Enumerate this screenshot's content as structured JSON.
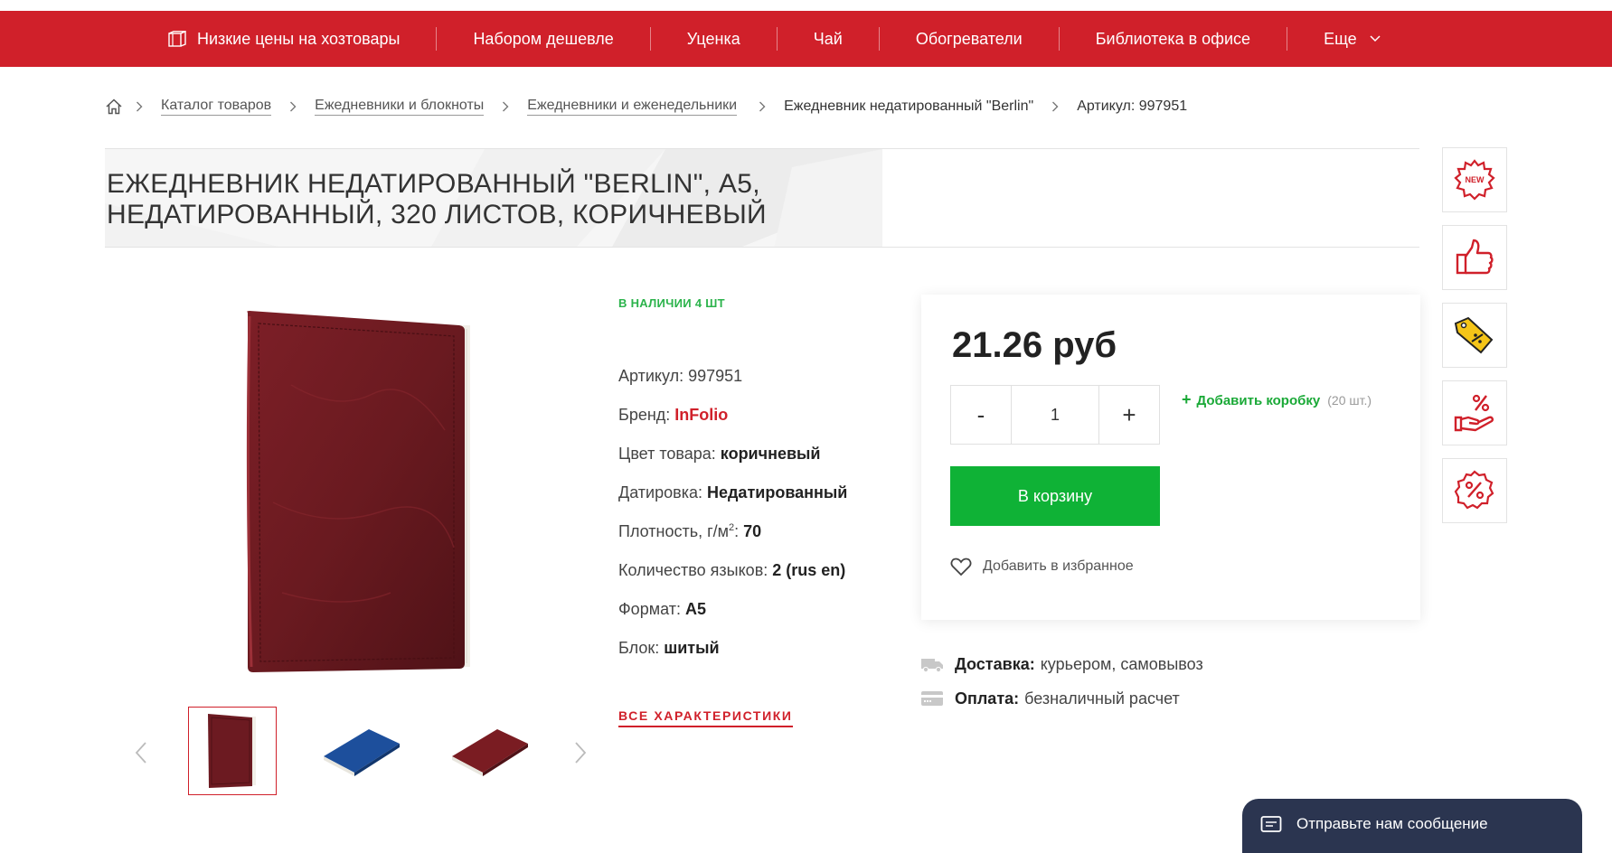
{
  "nav": {
    "items": [
      "Низкие цены на хозтовары",
      "Набором дешевле",
      "Уценка",
      "Чай",
      "Обогреватели",
      "Библиотека в офисе",
      "Еще"
    ]
  },
  "breadcrumb": {
    "links": [
      "Каталог товаров",
      "Ежедневники и блокноты",
      "Ежедневники и еженедельники"
    ],
    "current": "Ежедневник недатированный \"Berlin\"",
    "article": "Артикул: 997951"
  },
  "product": {
    "title": "ЕЖЕДНЕВНИК НЕДАТИРОВАННЫЙ \"BERLIN\", А5, НЕДАТИРОВАННЫЙ, 320 ЛИСТОВ, КОРИЧНЕВЫЙ",
    "stock": "В НАЛИЧИИ 4 ШТ",
    "props": {
      "article_label": "Артикул:",
      "article_value": "997951",
      "brand_label": "Бренд:",
      "brand_value": "InFolio",
      "color_label": "Цвет товара:",
      "color_value": "коричневый",
      "dating_label": "Датировка:",
      "dating_value": "Недатированный",
      "density_label": "Плотность, г/м",
      "density_sup": "2",
      "density_value": "70",
      "langs_label": "Количество языков:",
      "langs_value": "2 (rus en)",
      "format_label": "Формат:",
      "format_value": "А5",
      "block_label": "Блок:",
      "block_value": "шитый"
    },
    "all_chars": "ВСЕ ХАРАКТЕРИСТИКИ",
    "colors": {
      "brown": "#7a1c22",
      "blue": "#1d4f9c"
    }
  },
  "buy": {
    "price": "21.26 руб",
    "minus": "-",
    "qty": "1",
    "plus": "+",
    "add_box_plus": "+",
    "add_box": "Добавить коробку",
    "add_box_count": "(20 шт.)",
    "cart": "В корзину",
    "favorite": "Добавить в избранное"
  },
  "delivery": {
    "delivery_label": "Доставка:",
    "delivery_value": "курьером, самовывоз",
    "payment_label": "Оплата:",
    "payment_value": "безналичный расчет"
  },
  "chat": {
    "label": "Отправьте нам сообщение"
  },
  "side_badges": [
    "NEW"
  ],
  "theme": {
    "brand_red": "#d0202a",
    "green": "#0fb236",
    "chat_bg": "#2b3550"
  }
}
